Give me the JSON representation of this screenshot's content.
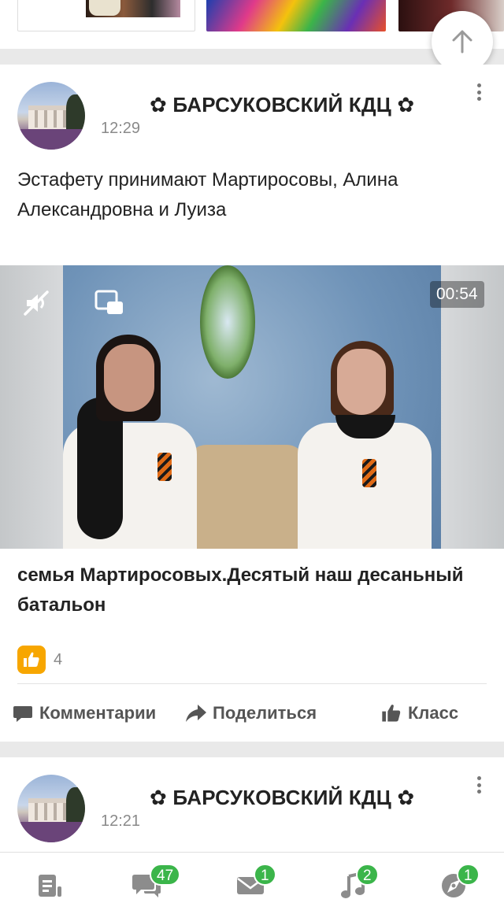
{
  "scroll_up": {
    "icon": "arrow-up-icon"
  },
  "posts": [
    {
      "author": "✿ БАРСУКОВСКИЙ КДЦ ✿",
      "time": "12:29",
      "text": "Эстафету принимают Мартиросовы, Алина Александровна и Луиза",
      "video": {
        "duration": "00:54",
        "title": "семья Мартиросовых.Десятый наш десаньный батальон"
      },
      "likes": "4",
      "actions": {
        "comment_label": "Комментарии",
        "share_label": "Поделиться",
        "class_label": "Класс"
      }
    },
    {
      "author": "✿ БАРСУКОВСКИЙ КДЦ ✿",
      "time": "12:21"
    }
  ],
  "bottom_nav": {
    "feed": {
      "icon": "feed-icon"
    },
    "chat": {
      "icon": "chat-icon",
      "badge": "47"
    },
    "mail": {
      "icon": "mail-icon",
      "badge": "1"
    },
    "music": {
      "icon": "music-icon",
      "badge": "2"
    },
    "discover": {
      "icon": "discover-icon",
      "badge": "1"
    }
  },
  "colors": {
    "accent_orange": "#f7a600",
    "badge_green": "#3bb54a"
  }
}
